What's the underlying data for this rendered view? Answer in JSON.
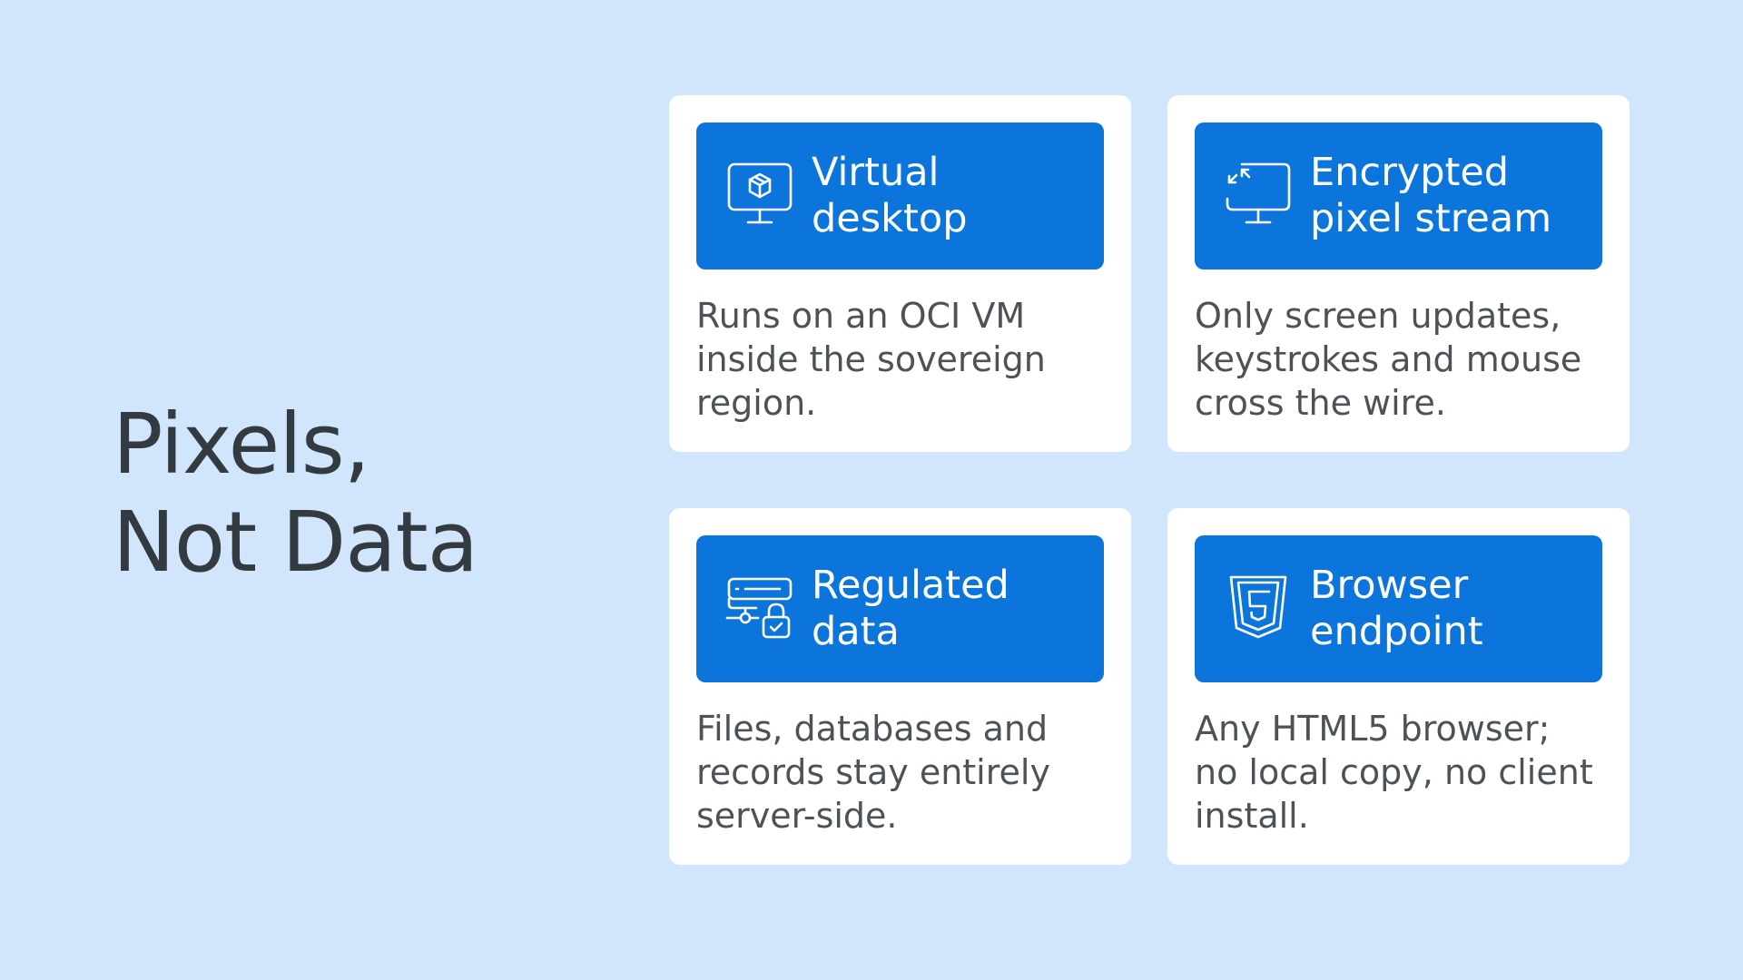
{
  "title": {
    "lines": [
      "Pixels,",
      "Not Data"
    ]
  },
  "cards": [
    {
      "icon": "monitor-cube-icon",
      "title_lines": [
        "Virtual",
        "desktop"
      ],
      "desc_lines": [
        "Runs on an OCI VM",
        "inside the sovereign",
        "region."
      ]
    },
    {
      "icon": "monitor-arrows-icon",
      "title_lines": [
        "Encrypted",
        "pixel stream"
      ],
      "desc_lines": [
        "Only screen updates,",
        "keystrokes and mouse",
        "cross the wire."
      ]
    },
    {
      "icon": "server-lock-icon",
      "title_lines": [
        "Regulated",
        "data"
      ],
      "desc_lines": [
        "Files, databases and",
        "records stay entirely",
        "server-side."
      ]
    },
    {
      "icon": "html5-shield-icon",
      "title_lines": [
        "Browser",
        "endpoint"
      ],
      "desc_lines": [
        "Any HTML5 browser;",
        "no local copy, no client",
        "install."
      ]
    }
  ],
  "colors": {
    "background": "#d1e6fd",
    "card": "#ffffff",
    "header": "#0b75dc",
    "title_text": "#333a40",
    "body_text": "#4d5257"
  }
}
